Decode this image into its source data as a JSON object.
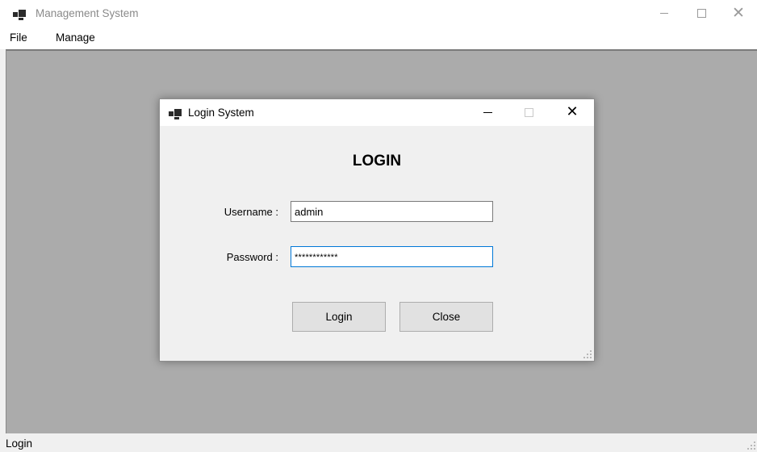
{
  "main_window": {
    "title": "Management System",
    "controls": {
      "close_glyph": "✕"
    }
  },
  "menu": [
    {
      "label": "File"
    },
    {
      "label": "Manage"
    }
  ],
  "statusbar": {
    "text": "Login"
  },
  "login_dialog": {
    "title": "Login System",
    "controls": {
      "close_glyph": "✕"
    },
    "heading": "LOGIN",
    "username": {
      "label": "Username :",
      "value": "admin"
    },
    "password": {
      "label": "Password :",
      "value": "************"
    },
    "buttons": {
      "login": "Login",
      "close": "Close"
    }
  },
  "colors": {
    "mdi_background": "#ababab",
    "focus_border": "#0078d7",
    "button_face": "#e1e1e1",
    "window_face": "#f0f0f0"
  },
  "icons": {
    "app": "windows-forms-app-icon",
    "minimize": "minimize-icon",
    "maximize": "maximize-icon",
    "close": "close-icon",
    "grip": "resize-grip-icon"
  }
}
